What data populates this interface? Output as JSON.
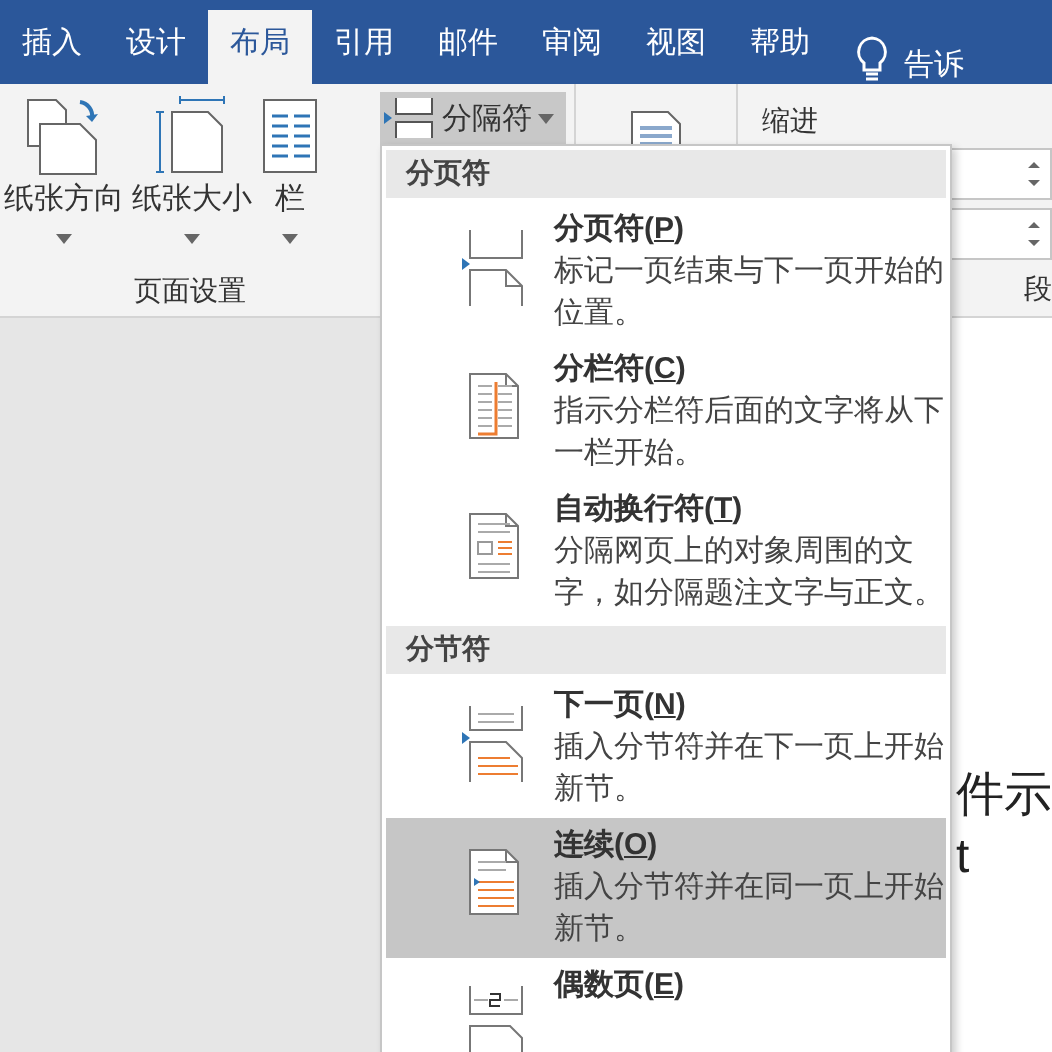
{
  "tabs": [
    {
      "label": "插入",
      "selected": false
    },
    {
      "label": "设计",
      "selected": false
    },
    {
      "label": "布局",
      "selected": true
    },
    {
      "label": "引用",
      "selected": false
    },
    {
      "label": "邮件",
      "selected": false
    },
    {
      "label": "审阅",
      "selected": false
    },
    {
      "label": "视图",
      "selected": false
    },
    {
      "label": "帮助",
      "selected": false
    }
  ],
  "tell_me": "告诉",
  "ribbon": {
    "page_setup": [
      {
        "kind": "orientation",
        "label": "纸张方向"
      },
      {
        "kind": "size",
        "label": "纸张大小"
      },
      {
        "kind": "columns",
        "label": "栏"
      }
    ],
    "breaks_button": {
      "label": "分隔符",
      "pressed": true
    },
    "group_label": "页面设置",
    "indent_label": "缩进",
    "paragraph_label": "段"
  },
  "document": {
    "lines": [
      "件示",
      "t"
    ]
  },
  "menu": {
    "sections": [
      {
        "header": "分页符",
        "items": [
          {
            "kind": "page",
            "title": [
              "分页符(",
              "P",
              ")"
            ],
            "description": "标记一页结束与下一页开始的位置。",
            "selected": false
          },
          {
            "kind": "column",
            "title": [
              "分栏符(",
              "C",
              ")"
            ],
            "description": "指示分栏符后面的文字将从下一栏开始。",
            "selected": false
          },
          {
            "kind": "wrap",
            "title": [
              "自动换行符(",
              "T",
              ")"
            ],
            "description": "分隔网页上的对象周围的文字，如分隔题注文字与正文。",
            "selected": false
          }
        ]
      },
      {
        "header": "分节符",
        "items": [
          {
            "kind": "next",
            "title": [
              "下一页(",
              "N",
              ")"
            ],
            "description": "插入分节符并在下一页上开始新节。",
            "selected": false
          },
          {
            "kind": "continuous",
            "title": [
              "连续(",
              "O",
              ")"
            ],
            "description": "插入分节符并在同一页上开始新节。",
            "selected": true
          },
          {
            "kind": "even",
            "title": [
              "偶数页(",
              "E",
              ")"
            ],
            "selected": false
          }
        ]
      }
    ]
  }
}
